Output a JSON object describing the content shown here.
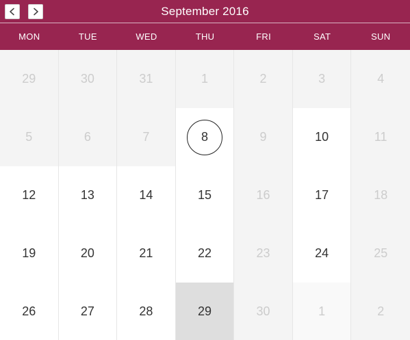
{
  "header": {
    "title": "September 2016",
    "prev_icon": "chevron-left-icon",
    "next_icon": "chevron-right-icon"
  },
  "weekdays": [
    "MON",
    "TUE",
    "WED",
    "THU",
    "FRI",
    "SAT",
    "SUN"
  ],
  "colors": {
    "header_bg": "#982550",
    "header_text": "#ffffff",
    "muted_bg": "#f4f4f4",
    "muted_text": "#cccccc",
    "today_bg": "#dedede",
    "day_text": "#333333"
  },
  "weeks": [
    [
      {
        "day": "29",
        "state": "muted"
      },
      {
        "day": "30",
        "state": "muted"
      },
      {
        "day": "31",
        "state": "muted"
      },
      {
        "day": "1",
        "state": "muted"
      },
      {
        "day": "2",
        "state": "muted"
      },
      {
        "day": "3",
        "state": "muted"
      },
      {
        "day": "4",
        "state": "muted"
      }
    ],
    [
      {
        "day": "5",
        "state": "muted"
      },
      {
        "day": "6",
        "state": "muted"
      },
      {
        "day": "7",
        "state": "muted"
      },
      {
        "day": "8",
        "state": "selected"
      },
      {
        "day": "9",
        "state": "muted"
      },
      {
        "day": "10",
        "state": "active"
      },
      {
        "day": "11",
        "state": "muted"
      }
    ],
    [
      {
        "day": "12",
        "state": "active"
      },
      {
        "day": "13",
        "state": "active"
      },
      {
        "day": "14",
        "state": "active"
      },
      {
        "day": "15",
        "state": "active"
      },
      {
        "day": "16",
        "state": "muted"
      },
      {
        "day": "17",
        "state": "active"
      },
      {
        "day": "18",
        "state": "muted"
      }
    ],
    [
      {
        "day": "19",
        "state": "active"
      },
      {
        "day": "20",
        "state": "active"
      },
      {
        "day": "21",
        "state": "active"
      },
      {
        "day": "22",
        "state": "active"
      },
      {
        "day": "23",
        "state": "muted"
      },
      {
        "day": "24",
        "state": "active"
      },
      {
        "day": "25",
        "state": "muted"
      }
    ],
    [
      {
        "day": "26",
        "state": "active"
      },
      {
        "day": "27",
        "state": "active"
      },
      {
        "day": "28",
        "state": "active"
      },
      {
        "day": "29",
        "state": "today"
      },
      {
        "day": "30",
        "state": "muted"
      },
      {
        "day": "1",
        "state": "light"
      },
      {
        "day": "2",
        "state": "muted"
      }
    ]
  ]
}
